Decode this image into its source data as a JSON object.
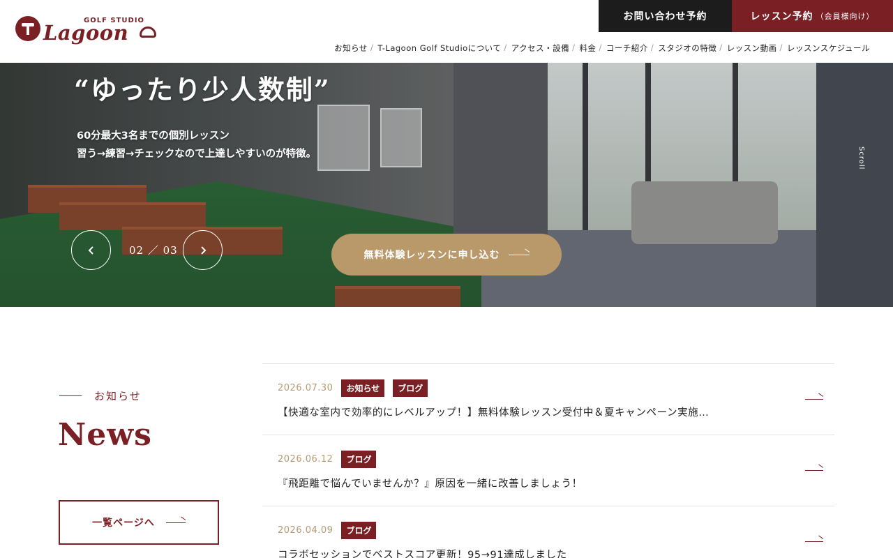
{
  "brand": {
    "tagline": "GOLF STUDIO",
    "name": "Lagoon"
  },
  "header_buttons": {
    "contact": "お問い合わせ予約",
    "lesson": "レッスン予約",
    "lesson_sub": "（会員様向け）"
  },
  "nav": [
    "お知らせ",
    "T-Lagoon Golf Studioについて",
    "アクセス・設備",
    "料金",
    "コーチ紹介",
    "スタジオの特徴",
    "レッスン動画",
    "レッスンスケジュール"
  ],
  "hero": {
    "title": "“ゆったり少人数制”",
    "desc_line1": "60分最大3名までの個別レッスン",
    "desc_line2": "習う→練習→チェックなので上達しやすいのが特徴。",
    "slide_counter": "02 ／ 03",
    "prev_icon": "chevron-left-icon",
    "next_icon": "chevron-right-icon",
    "cta": "無料体験レッスンに申し込む",
    "scroll": "Scroll"
  },
  "news": {
    "subtitle": "お知らせ",
    "title": "News",
    "more": "一覧ページへ",
    "items": [
      {
        "date": "2026.07.30",
        "tags": [
          "お知らせ",
          "ブログ"
        ],
        "title": "【快適な室内で効率的にレベルアップ！】無料体験レッスン受付中＆夏キャンペーン実施…"
      },
      {
        "date": "2026.06.12",
        "tags": [
          "ブログ"
        ],
        "title": "『飛距離で悩んでいませんか？』原因を一緒に改善しましょう！"
      },
      {
        "date": "2026.04.09",
        "tags": [
          "ブログ"
        ],
        "title": "コラボセッションでベストスコア更新！95→91達成しました"
      }
    ]
  },
  "colors": {
    "brand": "#7a1f24",
    "dark": "#1c1c1c",
    "gold": "#b9996a"
  }
}
